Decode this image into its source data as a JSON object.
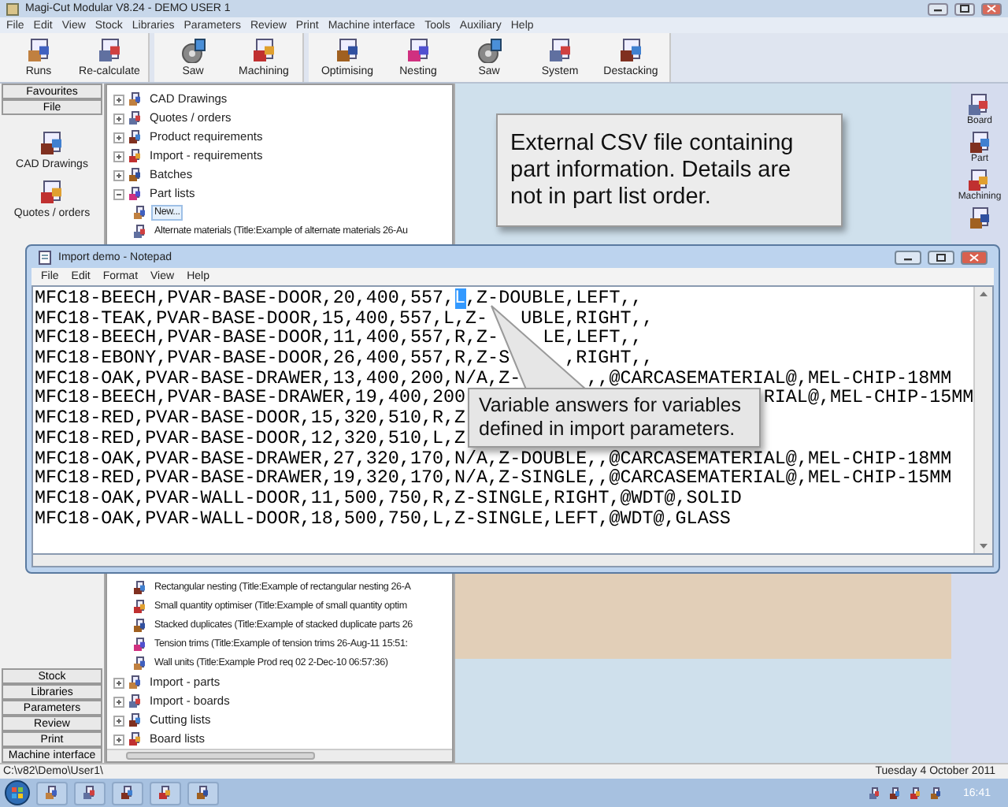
{
  "window": {
    "title": "Magi-Cut Modular V8.24 - DEMO USER 1"
  },
  "menu": [
    "File",
    "Edit",
    "View",
    "Stock",
    "Libraries",
    "Parameters",
    "Review",
    "Print",
    "Machine interface",
    "Tools",
    "Auxiliary",
    "Help"
  ],
  "toolbar_groups": [
    [
      "Runs",
      "Re-calculate"
    ],
    [
      "Saw",
      "Machining"
    ],
    [
      "Optimising",
      "Nesting",
      "Saw",
      "System",
      "Destacking"
    ]
  ],
  "sidebar": {
    "headers": [
      "Favourites",
      "File"
    ],
    "items": [
      "CAD Drawings",
      "Quotes / orders"
    ],
    "sections": [
      "Stock",
      "Libraries",
      "Parameters",
      "Review",
      "Print",
      "Machine interface"
    ]
  },
  "tree": {
    "items": [
      {
        "label": "CAD Drawings",
        "expanded": false,
        "selected": false
      },
      {
        "label": "Quotes / orders",
        "expanded": false,
        "selected": false
      },
      {
        "label": "Product requirements",
        "expanded": false,
        "selected": false
      },
      {
        "label": "Import - requirements",
        "expanded": false,
        "selected": false
      },
      {
        "label": "Batches",
        "expanded": false,
        "selected": false
      },
      {
        "label": "Part lists",
        "expanded": true,
        "selected": false,
        "children": [
          {
            "label": "New...",
            "selected": true
          },
          {
            "label": "Alternate materials (Title:Example of alternate materials 26-Au",
            "selected": false
          },
          {
            "label": "Rectangular nesting (Title:Example of rectangular nesting 26-A",
            "selected": false
          },
          {
            "label": "Small quantity optimiser (Title:Example of small quantity optim",
            "selected": false
          },
          {
            "label": "Stacked duplicates (Title:Example of stacked duplicate parts 26",
            "selected": false
          },
          {
            "label": "Tension trims (Title:Example of tension trims 26-Aug-11 15:51:",
            "selected": false
          },
          {
            "label": "Wall units (Title:Example Prod req 02 2-Dec-10 06:57:36)",
            "selected": false
          }
        ]
      },
      {
        "label": "Import - parts",
        "expanded": false,
        "selected": false
      },
      {
        "label": "Import - boards",
        "expanded": false,
        "selected": false
      },
      {
        "label": "Cutting lists",
        "expanded": false,
        "selected": false
      },
      {
        "label": "Board lists",
        "expanded": false,
        "selected": false
      }
    ]
  },
  "right_bar": {
    "items": [
      "Board",
      "Part",
      "Machining"
    ]
  },
  "callouts": [
    "External CSV file containing part information. Details are not in part list order.",
    "Variable answers for variables defined in import parameters."
  ],
  "notepad": {
    "title": "Import demo - Notepad",
    "menu": [
      "File",
      "Edit",
      "Format",
      "View",
      "Help"
    ],
    "lines": [
      [
        {
          "text": "MFC18-BEECH,PVAR-BASE-DOOR,20,400,557,",
          "selected": false
        },
        {
          "text": "L",
          "selected": true
        },
        {
          "text": ",Z-DOUBLE,LEFT,,",
          "selected": false
        }
      ],
      [
        {
          "text": "MFC18-TEAK,PVAR-BASE-DOOR,15,400,557,L,Z-",
          "selected": false
        },
        {
          "text": "UBLE,RIGHT,,",
          "selected": false
        }
      ],
      [
        {
          "text": "MFC18-BEECH,PVAR-BASE-DOOR,11,400,557,R,Z-",
          "selected": false
        },
        {
          "text": "LE,LEFT,,",
          "selected": false
        }
      ],
      [
        {
          "text": "MFC18-EBONY,PVAR-BASE-DOOR,26,400,557,R,Z-S",
          "selected": false
        },
        {
          "text": ",RIGHT,,",
          "selected": false
        }
      ],
      [
        {
          "text": "MFC18-OAK,PVAR-BASE-DRAWER,13,400,200,N/A,Z-",
          "selected": false
        },
        {
          "text": ",,@CARCASEMATERIAL@,MEL-CHIP-18MM",
          "selected": false
        }
      ],
      [
        {
          "text": "MFC18-BEECH,PVAR-BASE-DRAWER,19,400,200",
          "selected": false
        },
        {
          "text": "RIAL@,MEL-CHIP-15MM",
          "selected": false
        }
      ],
      [
        {
          "text": "MFC18-RED,PVAR-BASE-DOOR,15,320,510,R,Z",
          "selected": false
        }
      ],
      [
        {
          "text": "MFC18-RED,PVAR-BASE-DOOR,12,320,510,L,Z",
          "selected": false
        }
      ],
      [
        {
          "text": "MFC18-OAK,PVAR-BASE-DRAWER,27,320,170,N/A,Z-DOUBLE,,@CARCASEMATERIAL@,MEL-CHIP-18MM",
          "selected": false
        }
      ],
      [
        {
          "text": "MFC18-RED,PVAR-BASE-DRAWER,19,320,170,N/A,Z-SINGLE,,@CARCASEMATERIAL@,MEL-CHIP-15MM",
          "selected": false
        }
      ],
      [
        {
          "text": "MFC18-OAK,PVAR-WALL-DOOR,11,500,750,R,Z-SINGLE,RIGHT,@WDT@,SOLID",
          "selected": false
        }
      ],
      [
        {
          "text": "MFC18-OAK,PVAR-WALL-DOOR,18,500,750,L,Z-SINGLE,LEFT,@WDT@,GLASS",
          "selected": false
        }
      ]
    ]
  },
  "status_bar": {
    "path": "C:\\v82\\Demo\\User1\\",
    "date": "Tuesday 4 October 2011"
  },
  "taskbar": {
    "clock": "16:41"
  }
}
